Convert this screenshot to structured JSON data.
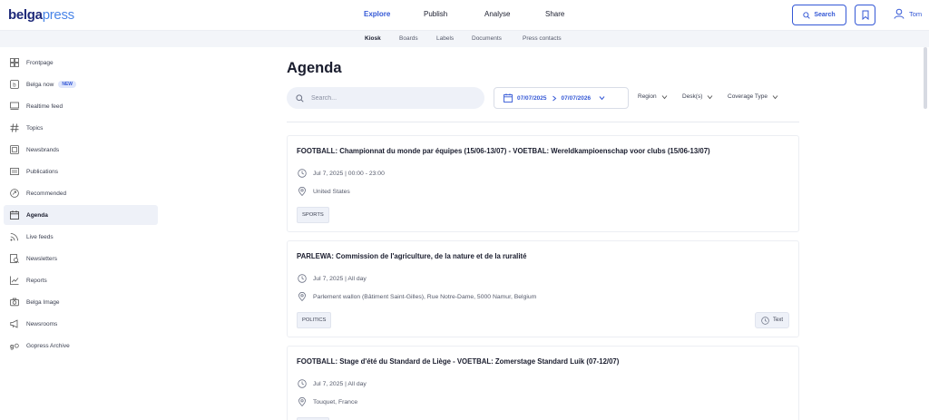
{
  "app": {
    "logo_part1": "belga",
    "logo_part2": "press"
  },
  "topnav": {
    "explore": "Explore",
    "publish": "Publish",
    "analyse": "Analyse",
    "share": "Share"
  },
  "actions": {
    "search_label": "Search",
    "user_name": "Tom"
  },
  "subnav": {
    "kiosk": "Kiosk",
    "boards": "Boards",
    "labels": "Labels",
    "documents": "Documents",
    "press_contacts": "Press contacts"
  },
  "sidebar": {
    "items": [
      {
        "label": "Frontpage",
        "icon": "frontpage-icon"
      },
      {
        "label": "Belga now",
        "icon": "belga-now-icon",
        "badge": "NEW"
      },
      {
        "label": "Realtime feed",
        "icon": "realtime-feed-icon"
      },
      {
        "label": "Topics",
        "icon": "hashtag-icon"
      },
      {
        "label": "Newsbrands",
        "icon": "newsbrands-icon"
      },
      {
        "label": "Publications",
        "icon": "publications-icon"
      },
      {
        "label": "Recommended",
        "icon": "recommended-icon"
      },
      {
        "label": "Agenda",
        "icon": "calendar-icon"
      },
      {
        "label": "Live feeds",
        "icon": "rss-icon"
      },
      {
        "label": "Newsletters",
        "icon": "newsletter-icon"
      },
      {
        "label": "Reports",
        "icon": "chart-icon"
      },
      {
        "label": "Belga Image",
        "icon": "camera-icon"
      },
      {
        "label": "Newsrooms",
        "icon": "megaphone-icon"
      },
      {
        "label": "Gopress Archive",
        "icon": "gopress-icon"
      }
    ],
    "active_index": 7
  },
  "main": {
    "title": "Agenda",
    "search_placeholder": "Search...",
    "date_from": "07/07/2025",
    "date_to": "07/07/2026",
    "filters": {
      "region": "Region",
      "desks": "Desk(s)",
      "coverage": "Coverage Type"
    }
  },
  "events": [
    {
      "title": "FOOTBALL: Championnat du monde par équipes (15/06-13/07) - VOETBAL: Wereldkampioenschap voor clubs (15/06-13/07)",
      "time": "Jul 7, 2025 | 00:00 - 23:00",
      "location": "United States",
      "tag": "SPORTS",
      "type": ""
    },
    {
      "title": "PARLEWA: Commission de l'agriculture, de la nature et de la ruralité",
      "time": "Jul 7, 2025 | All day",
      "location": "Parlement wallon (Bâtiment Saint-Gilles), Rue Notre-Dame, 5000 Namur, Belgium",
      "tag": "POLITICS",
      "type": "Text"
    },
    {
      "title": "FOOTBALL: Stage d'été du Standard de Liège - VOETBAL: Zomerstage Standard Luik (07-12/07)",
      "time": "Jul 7, 2025 | All day",
      "location": "Touquet, France",
      "tag": "",
      "type": ""
    }
  ],
  "colors": {
    "accent": "#3458d6",
    "text": "#1a1d2e",
    "muted": "#555a6b",
    "subnav_bg": "#f3f5f9"
  }
}
